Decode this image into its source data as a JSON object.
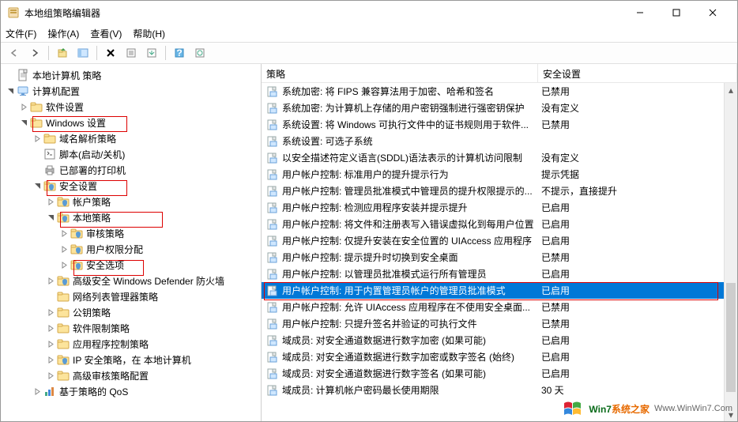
{
  "window": {
    "title": "本地组策略编辑器"
  },
  "menu": {
    "file": "文件(F)",
    "action": "操作(A)",
    "view": "查看(V)",
    "help": "帮助(H)"
  },
  "tree": {
    "root": "本地计算机 策略",
    "cc": "计算机配置",
    "sws": "软件设置",
    "ws": "Windows 设置",
    "dns": "域名解析策略",
    "script": "脚本(启动/关机)",
    "printer": "已部署的打印机",
    "sec": "安全设置",
    "acct": "帐户策略",
    "local": "本地策略",
    "audit": "审核策略",
    "rights": "用户权限分配",
    "secopt": "安全选项",
    "defender": "高级安全 Windows Defender 防火墙",
    "netlist": "网络列表管理器策略",
    "pubkey": "公钥策略",
    "swrestrict": "软件限制策略",
    "appctrl": "应用程序控制策略",
    "ipsec": "IP 安全策略，在 本地计算机",
    "advaudit": "高级审核策略配置",
    "qos": "基于策略的 QoS"
  },
  "cols": {
    "policy": "策略",
    "setting": "安全设置"
  },
  "rows": [
    {
      "p": "系统加密: 将 FIPS 兼容算法用于加密、哈希和签名",
      "s": "已禁用"
    },
    {
      "p": "系统加密: 为计算机上存储的用户密钥强制进行强密钥保护",
      "s": "没有定义"
    },
    {
      "p": "系统设置: 将 Windows 可执行文件中的证书规则用于软件...",
      "s": "已禁用"
    },
    {
      "p": "系统设置: 可选子系统",
      "s": ""
    },
    {
      "p": "以安全描述符定义语言(SDDL)语法表示的计算机访问限制",
      "s": "没有定义"
    },
    {
      "p": "用户帐户控制: 标准用户的提升提示行为",
      "s": "提示凭据"
    },
    {
      "p": "用户帐户控制: 管理员批准模式中管理员的提升权限提示的...",
      "s": "不提示，直接提升"
    },
    {
      "p": "用户帐户控制: 检测应用程序安装并提示提升",
      "s": "已启用"
    },
    {
      "p": "用户帐户控制: 将文件和注册表写入错误虚拟化到每用户位置",
      "s": "已启用"
    },
    {
      "p": "用户帐户控制: 仅提升安装在安全位置的 UIAccess 应用程序",
      "s": "已启用"
    },
    {
      "p": "用户帐户控制: 提示提升时切换到安全桌面",
      "s": "已禁用"
    },
    {
      "p": "用户帐户控制: 以管理员批准模式运行所有管理员",
      "s": "已启用"
    },
    {
      "p": "用户帐户控制: 用于内置管理员帐户的管理员批准模式",
      "s": "已启用",
      "sel": true
    },
    {
      "p": "用户帐户控制: 允许 UIAccess 应用程序在不使用安全桌面...",
      "s": "已禁用"
    },
    {
      "p": "用户帐户控制: 只提升签名并验证的可执行文件",
      "s": "已禁用"
    },
    {
      "p": "域成员: 对安全通道数据进行数字加密 (如果可能)",
      "s": "已启用"
    },
    {
      "p": "域成员: 对安全通道数据进行数字加密或数字签名 (始终)",
      "s": "已启用"
    },
    {
      "p": "域成员: 对安全通道数据进行数字签名 (如果可能)",
      "s": "已启用"
    },
    {
      "p": "域成员: 计算机帐户密码最长使用期限",
      "s": "30 天"
    }
  ],
  "wm": {
    "a": "Win7",
    "b": "系统之家",
    "c": "Www.WinWin7.Com"
  }
}
